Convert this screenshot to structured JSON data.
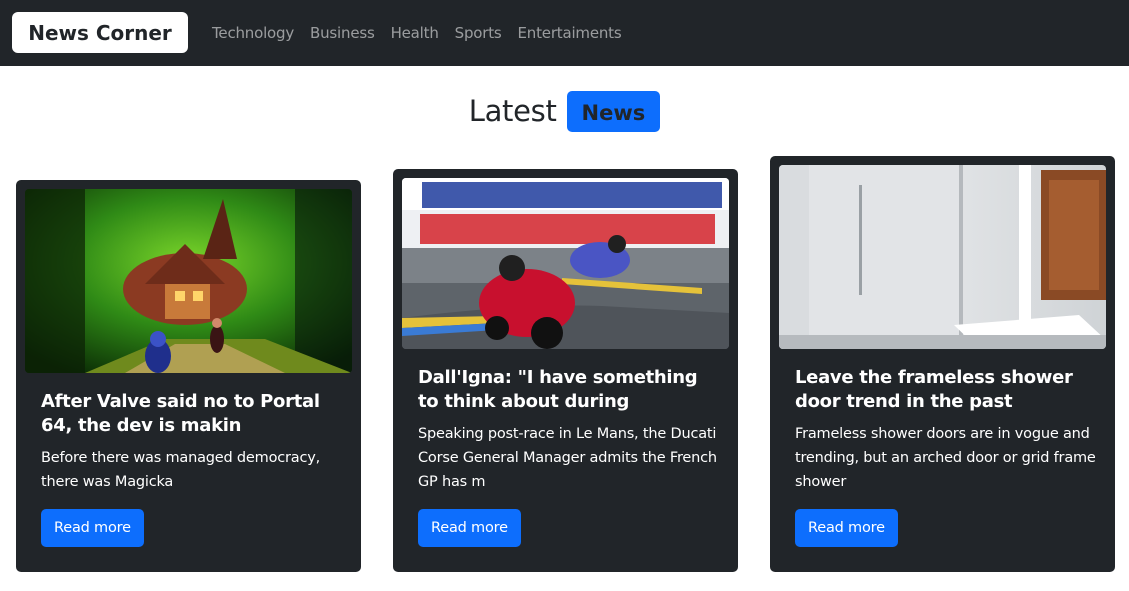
{
  "navbar": {
    "brand": "News Corner",
    "links": [
      "Technology",
      "Business",
      "Health",
      "Sports",
      "Entertaiments"
    ]
  },
  "heading": {
    "text": "Latest",
    "badge": "News"
  },
  "cards": [
    {
      "title": "After Valve said no to Portal 64, the dev is makin",
      "text": "Before there was managed democracy, there was Magicka",
      "button": "Read more",
      "image": "fantasy-game-house-image"
    },
    {
      "title": "Dall'Igna: \"I have something to think about during",
      "text": "Speaking post-race in Le Mans, the Ducati Corse General Manager admits the French GP has m",
      "button": "Read more",
      "image": "motogp-race-image"
    },
    {
      "title": "Leave the frameless shower door trend in the past",
      "text": "Frameless shower doors are in vogue and trending, but an arched door or grid frame shower",
      "button": "Read more",
      "image": "shower-bathroom-image"
    }
  ],
  "colors": {
    "navbar_bg": "#212529",
    "card_bg": "#212529",
    "accent": "#0d6efd",
    "nav_link": "rgba(255,255,255,0.55)"
  }
}
